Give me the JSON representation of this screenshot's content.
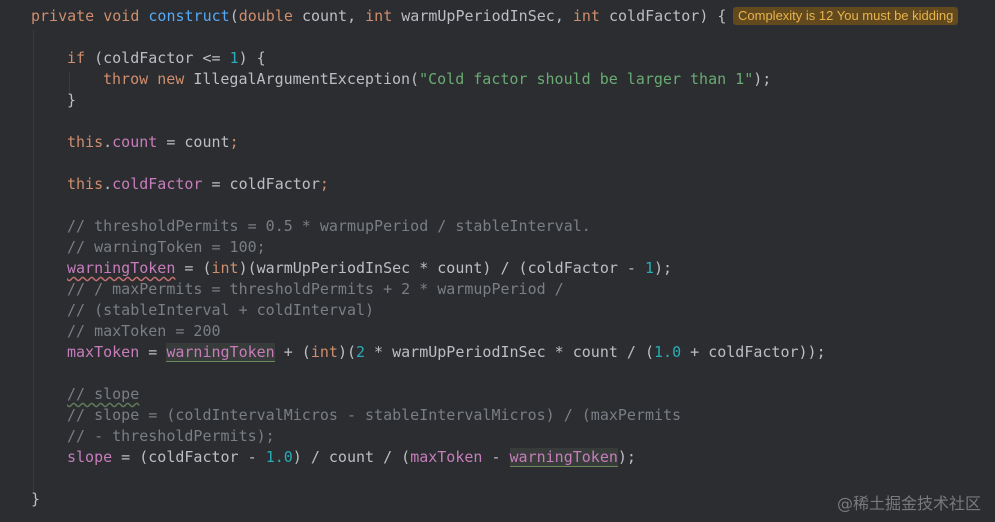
{
  "method": {
    "modifier": "private",
    "return_type": "void",
    "name": "construct",
    "p1_type": "double",
    "p1_name": "count",
    "p2_type": "int",
    "p2_name": "warmUpPeriodInSec",
    "p3_type": "int",
    "p3_name": "coldFactor",
    "open": ") {",
    "close": "}"
  },
  "complexity_hint": "Complexity is 12 You must be kidding",
  "code": {
    "if_kw": "if",
    "if_cond": "(coldFactor <= ",
    "if_num": "1",
    "if_end": ") {",
    "throw_kw": "throw",
    "new_kw": "new",
    "exception": "IllegalArgumentException(",
    "exception_msg": "\"Cold factor should be larger than 1\"",
    "exception_end": ");",
    "if_close": "}",
    "this_kw": "this",
    "count_field": "count",
    "count_assign": " = count",
    "cold_field": "coldFactor",
    "cold_assign": " = coldFactor",
    "semi": ";",
    "dot": ".",
    "c1": "// thresholdPermits = 0.5 * warmupPeriod / stableInterval.",
    "c2": "// warningToken = 100;",
    "warning_token": "warningToken",
    "wt_rhs_1": " = (",
    "int_kw": "int",
    "wt_rhs_2": ")(warmUpPeriodInSec * count) / (coldFactor - ",
    "wt_num": "1",
    "wt_end": ");",
    "c3": "// / maxPermits = thresholdPermits + 2 * warmupPeriod /",
    "c4": "// (stableInterval + coldInterval)",
    "c5": "// maxToken = 200",
    "max_token": "maxToken",
    "mt_rhs_1": " = ",
    "mt_rhs_2": " + (",
    "mt_rhs_3": ")(",
    "mt_num1": "2",
    "mt_rhs_4": " * warmUpPeriodInSec * count / (",
    "mt_num2": "1.0",
    "mt_rhs_5": " + coldFactor));",
    "c6": "// slope",
    "c7": "// slope = (coldIntervalMicros - stableIntervalMicros) / (maxPermits",
    "c8": "// - thresholdPermits);",
    "slope_field": "slope",
    "sl_rhs_1": " = (coldFactor - ",
    "sl_num": "1.0",
    "sl_rhs_2": ") / count / (",
    "sl_rhs_3": " - ",
    "sl_end": ");"
  },
  "watermark": "@稀土掘金技术社区"
}
